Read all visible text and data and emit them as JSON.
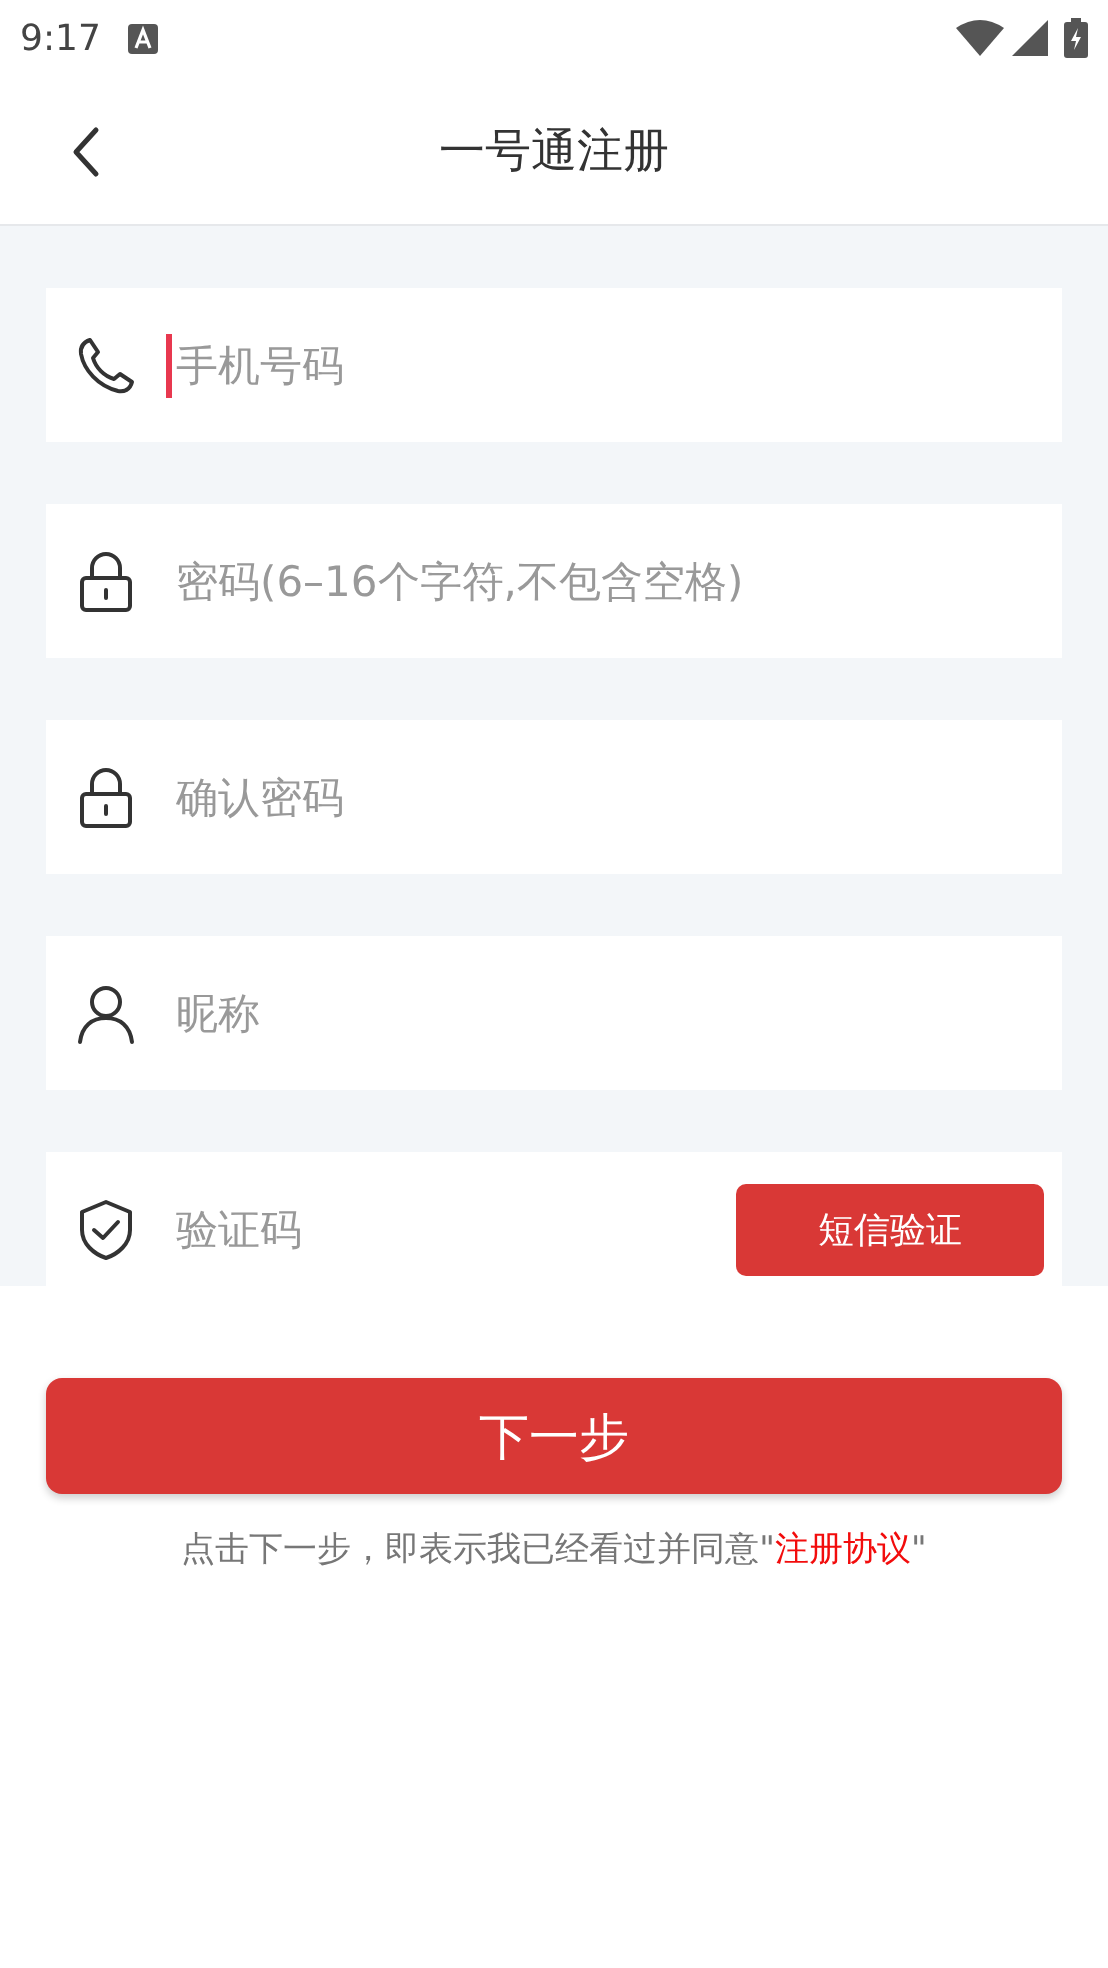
{
  "status_bar": {
    "time": "9:17"
  },
  "header": {
    "title": "一号通注册"
  },
  "fields": [
    {
      "kind": "phone",
      "placeholder": "手机号码",
      "focused": true
    },
    {
      "kind": "lock",
      "placeholder": "密码(6–16个字符,不包含空格)",
      "focused": false
    },
    {
      "kind": "lock",
      "placeholder": "确认密码",
      "focused": false
    },
    {
      "kind": "user",
      "placeholder": "昵称",
      "focused": false
    },
    {
      "kind": "shield",
      "placeholder": "验证码",
      "focused": false,
      "button": "短信验证"
    }
  ],
  "next_button": "下一步",
  "notice": {
    "text": "点击下一步，即表示我已经看过并同意\"",
    "link": "注册协议",
    "after": "\""
  }
}
